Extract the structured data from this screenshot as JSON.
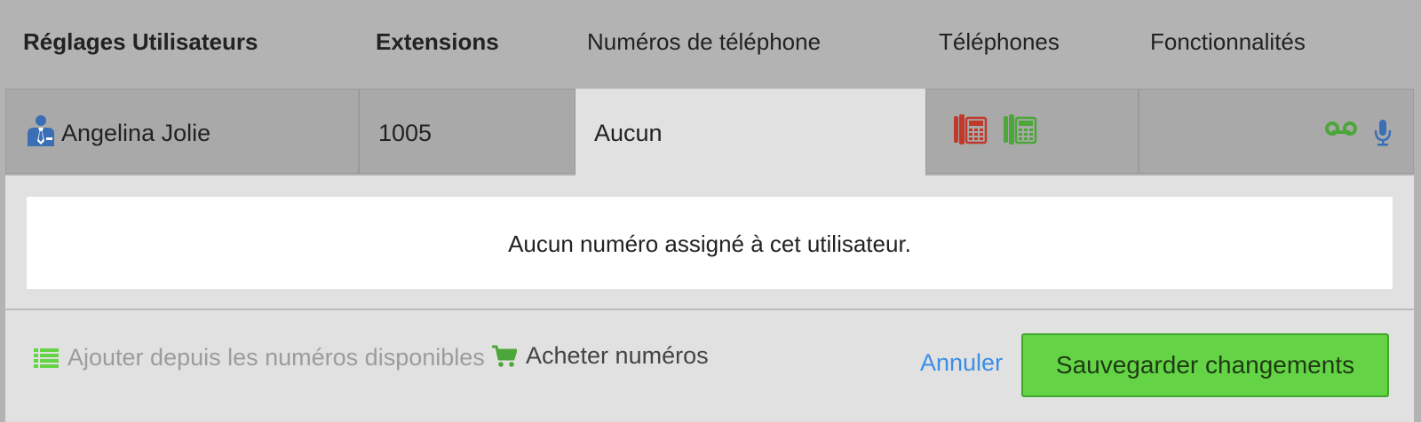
{
  "header": {
    "col_user": "Réglages Utilisateurs",
    "col_ext": "Extensions",
    "col_numbers": "Numéros de téléphone",
    "col_phones": "Téléphones",
    "col_features": "Fonctionnalités"
  },
  "row": {
    "user_name": "Angelina Jolie",
    "extension": "1005",
    "numbers_value": "Aucun"
  },
  "panel": {
    "empty_message": "Aucun numéro assigné à cet utilisateur.",
    "add_available_label": "Ajouter depuis les numéros disponibles",
    "buy_numbers_label": "Acheter numéros",
    "cancel_label": "Annuler",
    "save_label": "Sauvegarder changements"
  },
  "colors": {
    "accent_green": "#64d446",
    "link_blue": "#3a8ee6",
    "phone_red": "#c0392b",
    "phone_green": "#4ca63a",
    "user_icon_blue": "#3a6fb5"
  }
}
